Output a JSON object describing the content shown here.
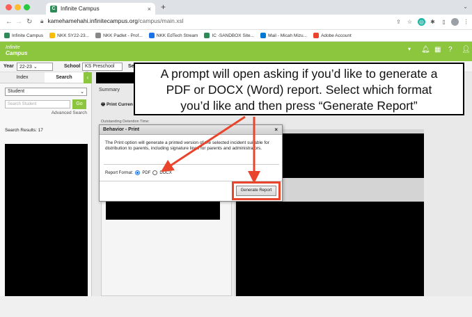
{
  "browser": {
    "tab_title": "Infinite Campus",
    "tab_favicon": "C",
    "url_host": "kamehamehahi.infinitecampus.org",
    "url_path": "/campus/main.xsl"
  },
  "bookmarks": [
    {
      "label": "Infinite Campus",
      "color": "#2e8b57"
    },
    {
      "label": "NKK SY22-23...",
      "color": "#fbbc05"
    },
    {
      "label": "NKK Padlet - Prof...",
      "color": "#888888"
    },
    {
      "label": "NKK EdTech Stream",
      "color": "#1a73e8"
    },
    {
      "label": "IC -SANDBOX Site...",
      "color": "#2e8b57"
    },
    {
      "label": "Mail - Micah Mizu...",
      "color": "#0078d4"
    },
    {
      "label": "Adobe Account",
      "color": "#e8452c"
    }
  ],
  "app": {
    "logo_line1": "Infinite",
    "logo_line2": "Campus",
    "accent": "#8cc63f"
  },
  "toolbar": {
    "year_label": "Year",
    "year_value": "22-23",
    "school_label": "School",
    "school_value": "KS Preschool",
    "section_label": "Section"
  },
  "left": {
    "tab_index": "Index",
    "tab_search": "Search",
    "student_select": "Student",
    "search_placeholder": "Search Student",
    "go_label": "Go",
    "advanced_search": "Advanced Search",
    "results": "Search Results: 17"
  },
  "main": {
    "tab_summary": "Summary",
    "print_label": "Print Curren",
    "subcaption": "Outstanding Detention Time:"
  },
  "modal": {
    "title": "Behavior - Print",
    "close": "×",
    "description": "The Print option will generate a printed version of the selected incident suitable for distribution to parents, including signature lines for parents and administrators.",
    "format_label": "Report Format:",
    "option_pdf": "PDF",
    "option_docx": "DOCX",
    "generate_button": "Generate Report"
  },
  "callout": {
    "line1": "A prompt will open asking if you’d like to generate a",
    "line2": "PDF or DOCX (Word) report.  Select which format",
    "line3": "you’d like and then press “Generate Report”"
  }
}
